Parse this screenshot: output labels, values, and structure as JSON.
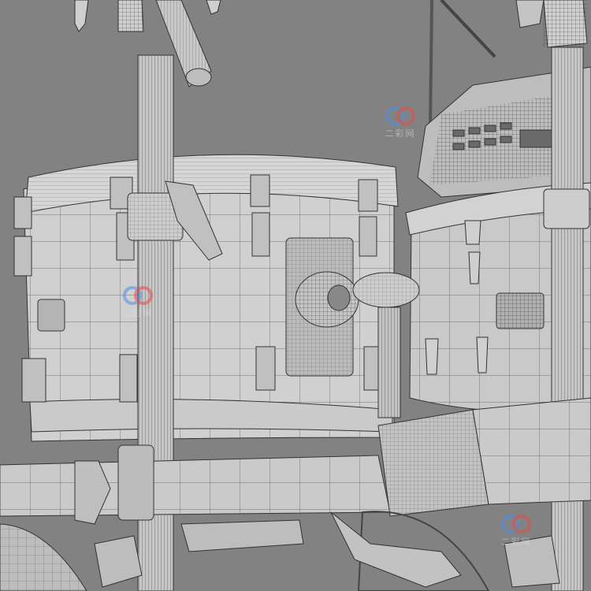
{
  "scene": {
    "subject": "drum-kit-wireframe-render",
    "background_color": "#828282",
    "mesh_fill_color": "#cfcfcf",
    "mesh_line_color": "#3a3a3a",
    "hardware_color": "#b9b9b9"
  },
  "watermarks": [
    {
      "text": "二彩网",
      "colors": [
        "#e84a4a",
        "#4a8fe8"
      ]
    },
    {
      "text": "二彩网",
      "colors": [
        "#e84a4a",
        "#4a8fe8"
      ]
    },
    {
      "text": "二彩网",
      "colors": [
        "#e84a4a",
        "#4a8fe8"
      ]
    }
  ]
}
